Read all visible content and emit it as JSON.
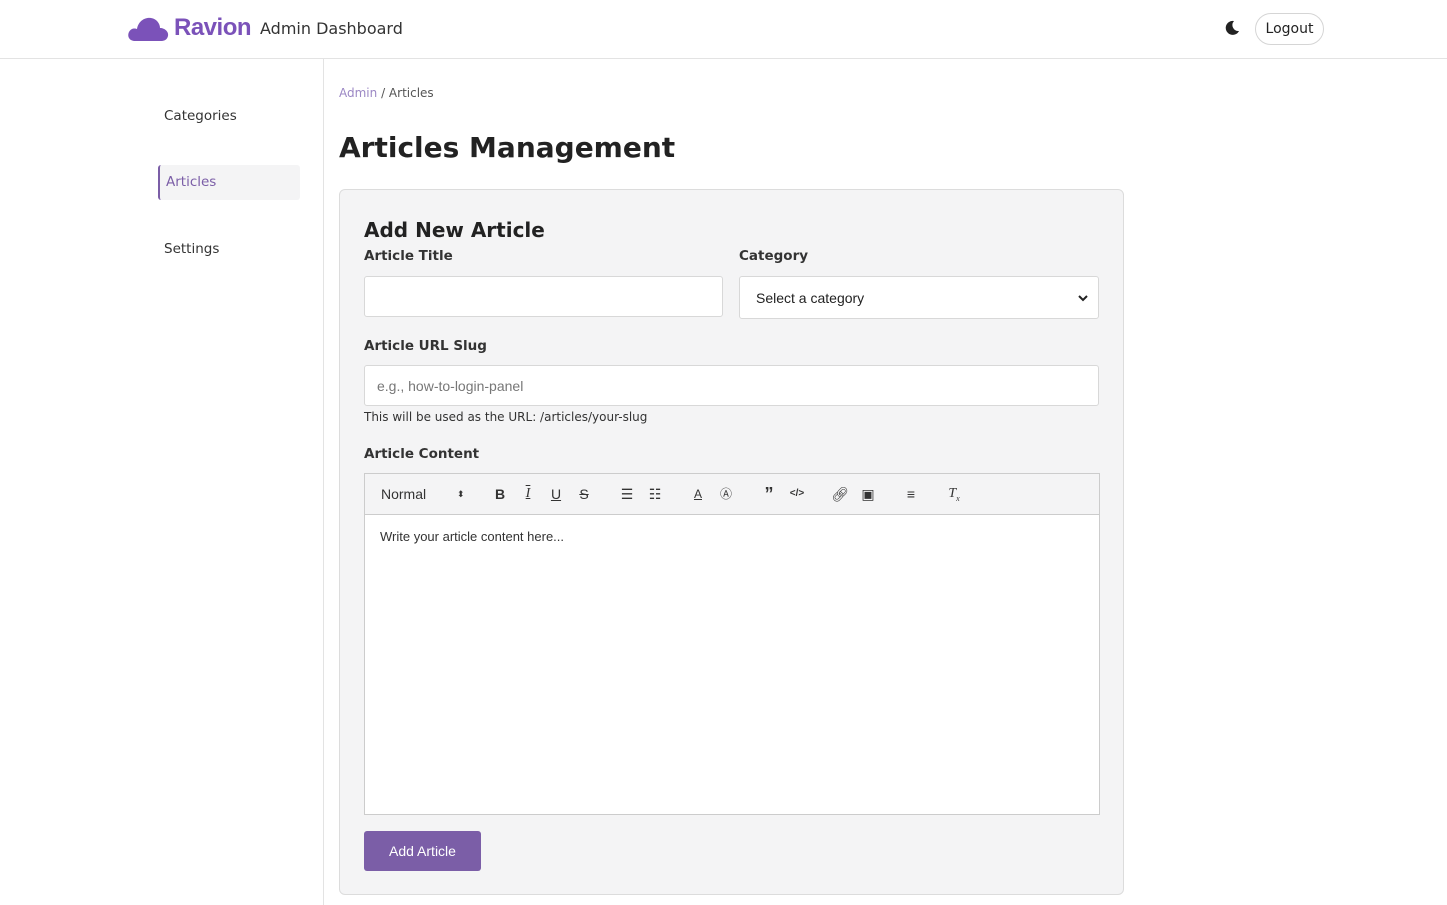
{
  "header": {
    "brand": "Ravion",
    "title": "Admin Dashboard",
    "logout": "Logout"
  },
  "sidebar": {
    "items": [
      {
        "label": "Categories"
      },
      {
        "label": "Articles"
      },
      {
        "label": "Settings"
      }
    ]
  },
  "breadcrumb": {
    "root": "Admin",
    "sep": " / ",
    "current": "Articles"
  },
  "page_title": "Articles Management",
  "form": {
    "heading": "Add New Article",
    "title_label": "Article Title",
    "title_value": "",
    "category_label": "Category",
    "category_selected": "Select a category",
    "slug_label": "Article URL Slug",
    "slug_placeholder": "e.g., how-to-login-panel",
    "slug_help": "This will be used as the URL: /articles/your-slug",
    "content_label": "Article Content",
    "format_select": "Normal",
    "content_placeholder": "Write your article content here...",
    "submit": "Add Article"
  },
  "colors": {
    "accent": "#7b5ea7",
    "brand": "#7b52b9"
  }
}
